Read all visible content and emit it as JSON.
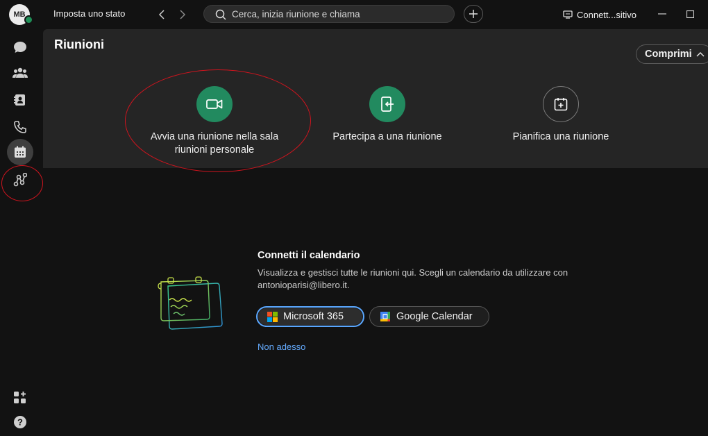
{
  "titlebar": {
    "avatar_initials": "MB",
    "status_label": "Imposta uno stato",
    "search_placeholder": "Cerca, inizia riunione e chiama",
    "connect_label": "Connett...sitivo",
    "icons": [
      "back-arrow-icon",
      "forward-arrow-icon",
      "search-icon",
      "plus-icon",
      "device-icon",
      "minimize-icon",
      "maximize-icon"
    ]
  },
  "sidebar": {
    "items": [
      {
        "name": "messaging",
        "icon": "chat-bubble-icon"
      },
      {
        "name": "teams",
        "icon": "people-icon"
      },
      {
        "name": "contacts",
        "icon": "contact-card-icon"
      },
      {
        "name": "calling",
        "icon": "phone-icon"
      },
      {
        "name": "meetings",
        "icon": "calendar-icon",
        "active": true
      },
      {
        "name": "workflows",
        "icon": "connector-icon"
      }
    ],
    "bottom": [
      {
        "name": "apps",
        "icon": "apps-grid-icon"
      },
      {
        "name": "help",
        "icon": "help-icon"
      }
    ]
  },
  "main": {
    "title": "Riunioni",
    "collapse_label": "Comprimi",
    "actions": [
      {
        "label": "Avvia una riunione nella sala riunioni personale",
        "icon": "video-camera-icon"
      },
      {
        "label": "Partecipa a una riunione",
        "icon": "join-door-icon"
      },
      {
        "label": "Pianifica una riunione",
        "icon": "calendar-add-icon"
      }
    ]
  },
  "calendar_connect": {
    "title": "Connetti il calendario",
    "description": "Visualizza e gestisci tutte le riunioni qui. Scegli un calendario da utilizzare con antonioparisi@libero.it.",
    "microsoft_label": "Microsoft 365",
    "google_label": "Google Calendar",
    "later_label": "Non adesso"
  },
  "colors": {
    "background": "#121212",
    "panel": "#252525",
    "accent_green": "#228a5f",
    "focus_blue": "#5aa7ff",
    "link_blue": "#64abff",
    "annotation_red": "#d0141e"
  }
}
